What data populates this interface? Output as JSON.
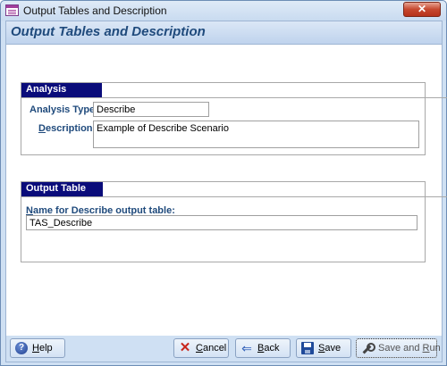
{
  "window": {
    "title": "Output Tables and Description",
    "close_glyph": "✕"
  },
  "form": {
    "header_title": "Output Tables and Description"
  },
  "analysis": {
    "section_title": "Analysis",
    "type_label": "Analysis Type:",
    "type_value": "Describe",
    "description_label_accel": "D",
    "description_label_rest": "escription:",
    "description_value": "Example of Describe Scenario"
  },
  "output_table": {
    "section_title": "Output Table",
    "name_label_accel": "N",
    "name_label_rest": "ame for Describe output table:",
    "name_value": "TAS_Describe"
  },
  "footer": {
    "help": {
      "accel": "H",
      "rest": "elp",
      "icon": "help-icon"
    },
    "cancel": {
      "accel": "C",
      "rest": "ancel",
      "icon": "cancel-icon"
    },
    "back": {
      "accel": "B",
      "rest": "ack",
      "icon": "back-arrow-icon"
    },
    "save": {
      "accel": "S",
      "rest": "ave",
      "icon": "floppy-disk-icon"
    },
    "save_and_run": {
      "prefix": "Save and ",
      "accel": "R",
      "rest": "un",
      "icon": "run-tool-icon"
    }
  },
  "colors": {
    "section_header_bg": "#0a0c7a",
    "label_text": "#1f4a7c",
    "window_frame": "#cfe0f3"
  }
}
